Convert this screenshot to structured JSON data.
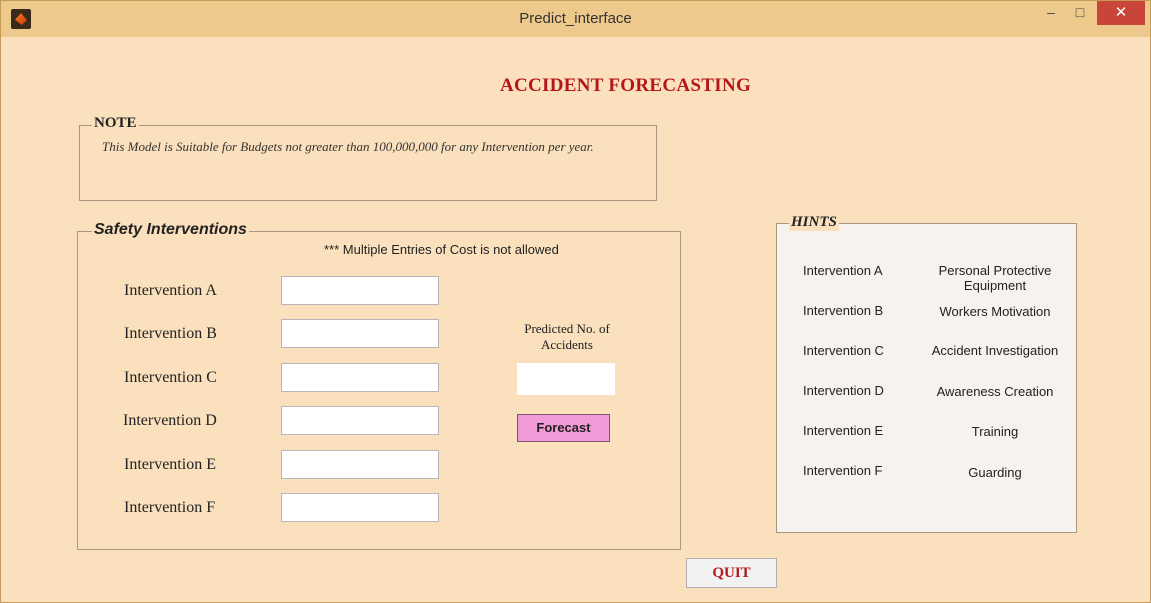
{
  "window": {
    "title": "Predict_interface",
    "minimize_glyph": "–",
    "maximize_glyph": "□",
    "close_glyph": "✕"
  },
  "main_title": "ACCIDENT FORECASTING",
  "note": {
    "label": "NOTE",
    "text": "This Model is Suitable for Budgets not greater than 100,000,000 for any Intervention per year."
  },
  "safety": {
    "label": "Safety Interventions",
    "multi_note": "*** Multiple Entries of Cost is not allowed",
    "interventions": [
      {
        "label": "Intervention A",
        "value": ""
      },
      {
        "label": "Intervention B",
        "value": ""
      },
      {
        "label": "Intervention C",
        "value": ""
      },
      {
        "label": "Intervention D",
        "value": ""
      },
      {
        "label": "Intervention E",
        "value": ""
      },
      {
        "label": "Intervention F",
        "value": ""
      }
    ],
    "predicted_label_line1": "Predicted No. of",
    "predicted_label_line2": "Accidents",
    "predicted_value": "",
    "forecast_label": "Forecast"
  },
  "hints": {
    "label": "HINTS",
    "rows": [
      {
        "intervention": "Intervention A",
        "description_line1": "Personal Protective",
        "description_line2": "Equipment"
      },
      {
        "intervention": "Intervention B",
        "description_line1": "Workers Motivation",
        "description_line2": ""
      },
      {
        "intervention": "Intervention C",
        "description_line1": "Accident Investigation",
        "description_line2": ""
      },
      {
        "intervention": "Intervention D",
        "description_line1": "Awareness Creation",
        "description_line2": ""
      },
      {
        "intervention": "Intervention E",
        "description_line1": "Training",
        "description_line2": ""
      },
      {
        "intervention": "Intervention F",
        "description_line1": "Guarding",
        "description_line2": ""
      }
    ]
  },
  "quit_label": "QUIT"
}
